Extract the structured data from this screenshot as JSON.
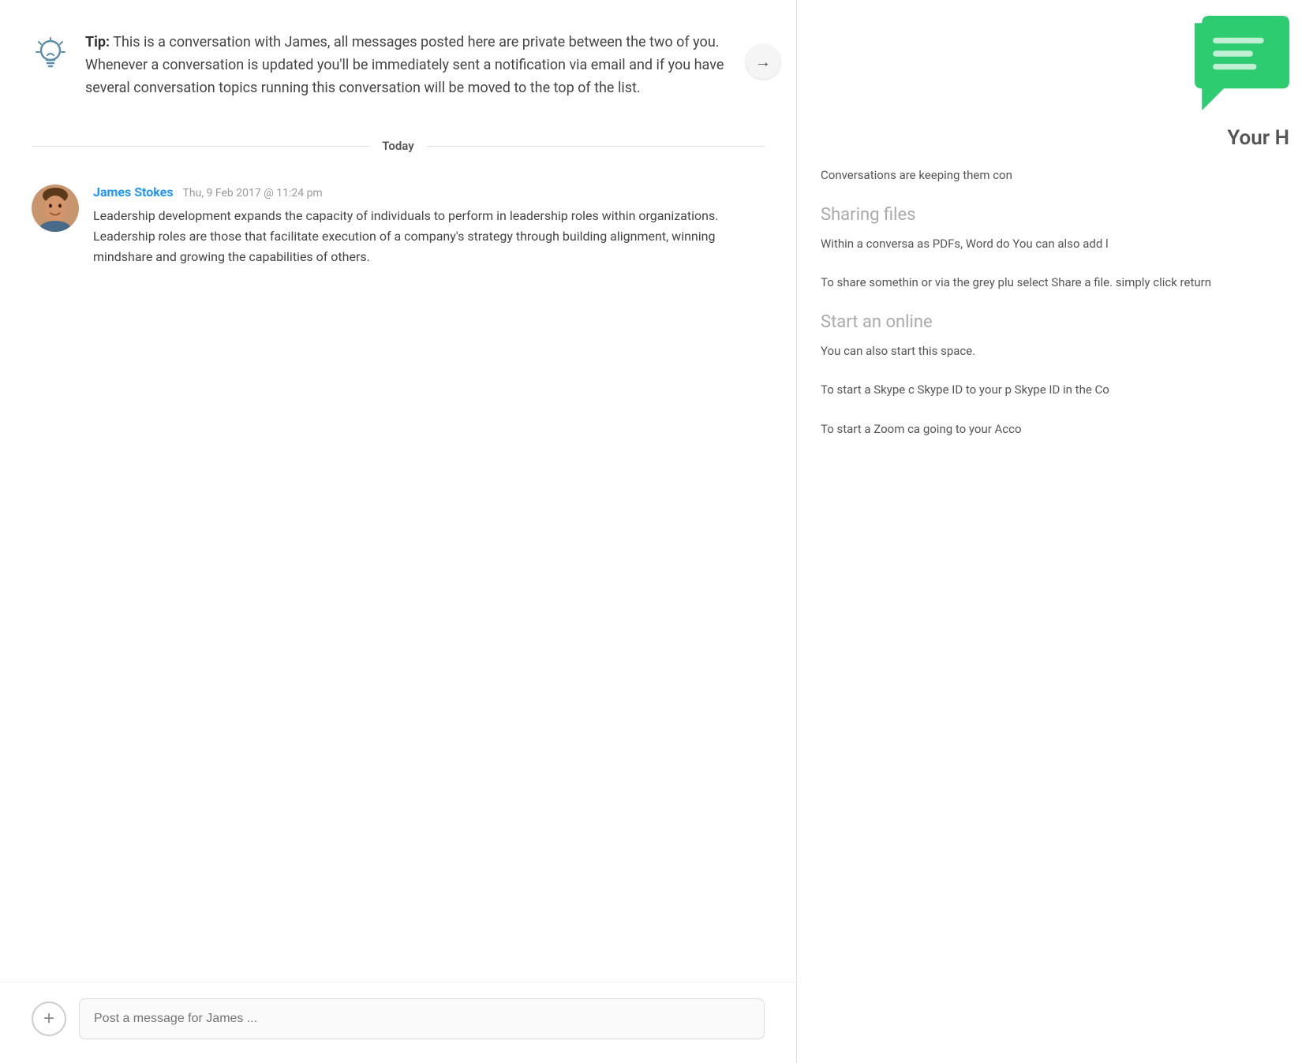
{
  "main": {
    "tip": {
      "label": "Tip:",
      "text": "This is a conversation with James, all messages posted here are private between the two of you. Whenever a conversation is updated you'll be immediately sent a notification via email and if you have several conversation topics running this conversation will be moved to the top of the list."
    },
    "date_divider": "Today",
    "message": {
      "author": "James Stokes",
      "time": "Thu, 9 Feb 2017 @ 11:24 pm",
      "body": "Leadership development expands the capacity of individuals to perform in leadership roles within organizations. Leadership roles are those that facilitate execution of a company's strategy through building alignment, winning mindshare and growing the capabilities of others."
    },
    "input_placeholder": "Post a message for James ...",
    "add_button_label": "+"
  },
  "sidebar": {
    "title": "Your H",
    "sections": [
      {
        "id": "conversations",
        "intro": "Conversations are keeping them con"
      },
      {
        "id": "sharing_files",
        "title": "Sharing files",
        "text": "Within a conversa as PDFs, Word do You can also add l"
      },
      {
        "id": "to_share",
        "text": "To share somethin or via the grey plu select Share a file. simply click return"
      },
      {
        "id": "start_online",
        "title": "Start an online",
        "text": "You can also start this space."
      },
      {
        "id": "start_skype",
        "text": "To start a Skype c Skype ID to your p Skype ID in the Co"
      },
      {
        "id": "start_zoom",
        "text": "To start a Zoom ca going to your Acco"
      }
    ]
  }
}
